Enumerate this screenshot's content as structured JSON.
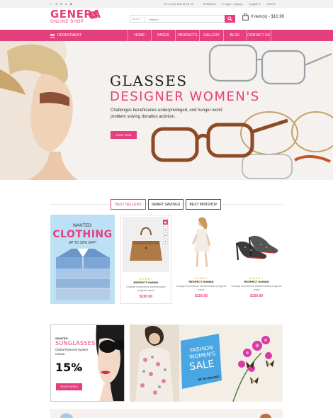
{
  "topbar": {
    "social_icons": [
      "facebook-icon",
      "twitter-icon",
      "instagram-icon",
      "pinterest-icon",
      "google-icon"
    ],
    "phone": "(+404) 158 14 25 78",
    "wishlist": "Wishlist",
    "login": "Login / Signup",
    "language": "English",
    "currency": "USD"
  },
  "logo": {
    "name": "GENERA",
    "badge": "L",
    "tagline": "ONLINE SHOP"
  },
  "search": {
    "category": "ALL",
    "placeholder": "Search..."
  },
  "cart": {
    "summary": "0 item(s) - $10.99"
  },
  "nav": {
    "department": "DEPARTMENT",
    "items": [
      "HOME",
      "PAGES",
      "PRODUCTS",
      "GALLERY",
      "BLOG",
      "CONTACT US"
    ]
  },
  "hero": {
    "title": "GLASSES",
    "subtitle": "DESIGNER WOMEN'S",
    "description": "Challenges beneficiaries underprivileged, end hunger world problem solving donation activism.",
    "button": "SHOP NOW"
  },
  "tabs": [
    "BEST SELLERS",
    "SMART SAVINGS",
    "BEST MINISHOP"
  ],
  "promo": {
    "wanted": "WANTED:",
    "title": "CLOTHING",
    "offer": "UP TO 50% OFF*"
  },
  "products": [
    {
      "name": "RESPECT HUMAN",
      "desc": "Change movements transformative progress equal",
      "price": "$150.00",
      "rating": 4
    },
    {
      "name": "RESPECT HUMAN",
      "desc": "Change movements transformative progress equal",
      "price": "$150.00",
      "rating": 4
    },
    {
      "name": "RESPECT HUMAN",
      "desc": "Change movements transformative progress equal",
      "price": "$150.00",
      "rating": 4
    }
  ],
  "sunglasses_banner": {
    "wanted": "WANTED:",
    "title": "SUNGLASSES",
    "text": "Global financial system rescue",
    "percent": "15%",
    "off": "OFF",
    "button": "SHOP NOW !"
  },
  "fashion_banner": {
    "line1": "FASHION WOMEN'S",
    "line2": "SALE",
    "line3": "UP TO 60% OFF*"
  },
  "colors": {
    "accent": "#e5407e",
    "topbar": "#f2f2f2",
    "promo_bg": "#bde0f4",
    "fashion_box": "#49a6e3"
  }
}
